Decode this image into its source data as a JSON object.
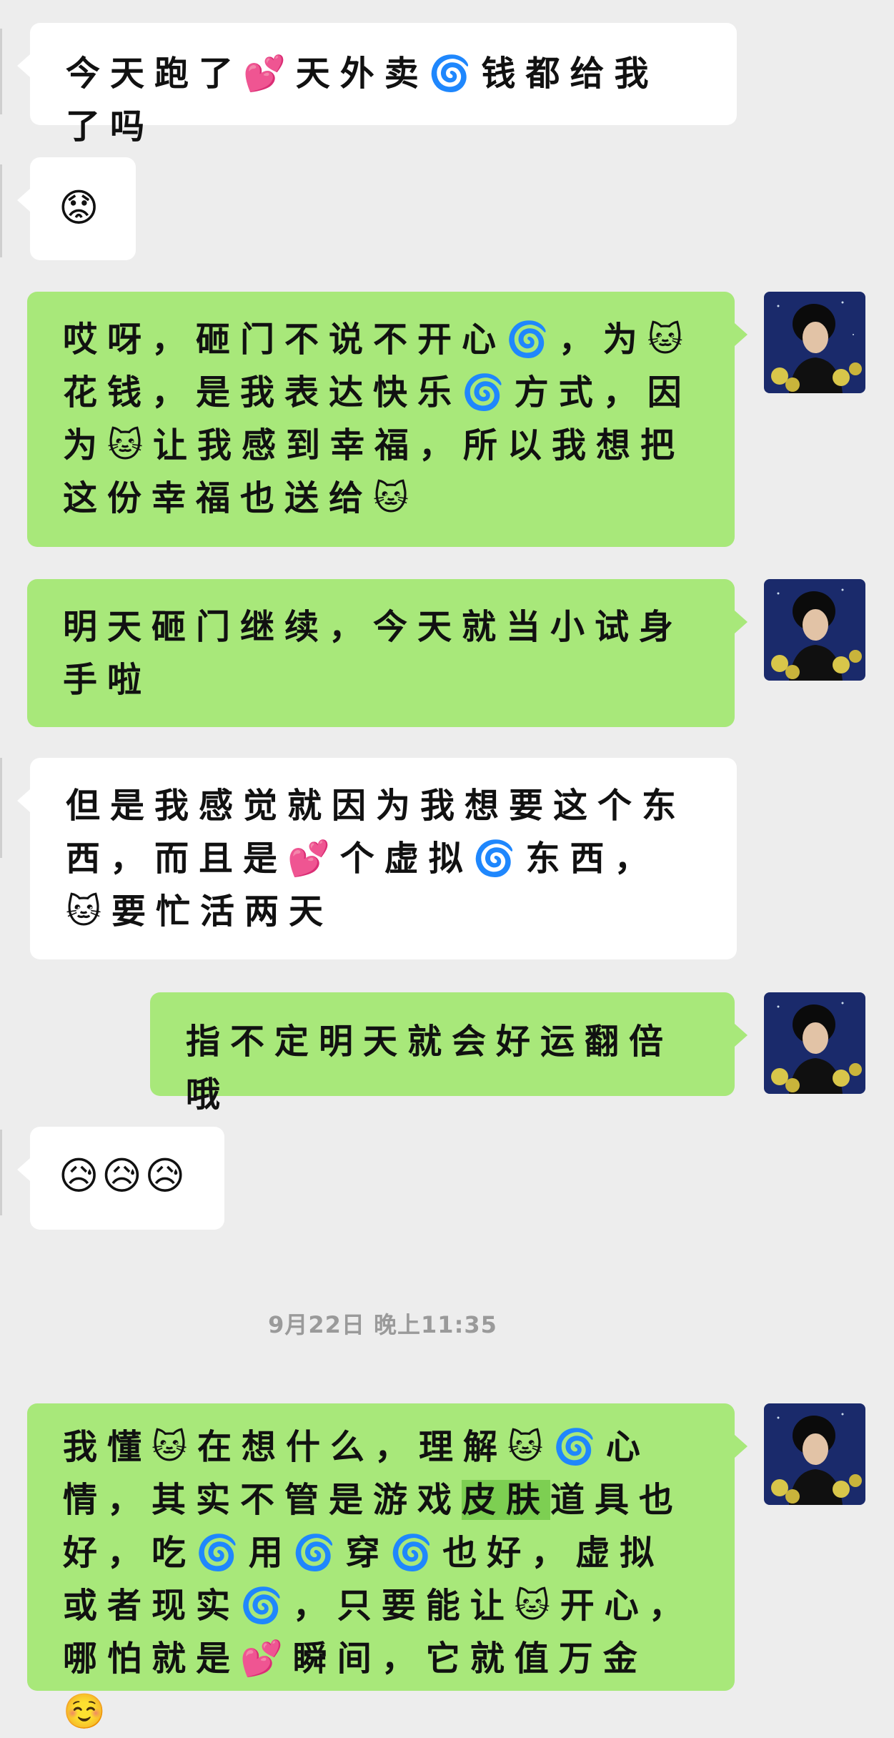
{
  "chat": {
    "messages": [
      {
        "side": "left",
        "text": "今天跑了💕天外卖🌀钱都给我了吗"
      },
      {
        "side": "left",
        "text": "😟"
      },
      {
        "side": "right",
        "text": "哎呀，砸门不说不开心🌀，为🐱花钱，是我表达快乐🌀方式，因为🐱让我感到幸福，所以我想把这份幸福也送给🐱"
      },
      {
        "side": "right",
        "text": "明天砸门继续，今天就当小试身手啦"
      },
      {
        "side": "left",
        "text": "但是我感觉就因为我想要这个东西，而且是💕个虚拟🌀东西，🐱要忙活两天"
      },
      {
        "side": "right",
        "text": "指不定明天就会好运翻倍哦"
      },
      {
        "side": "left",
        "text": "😥😥😥"
      },
      {
        "side": "right",
        "text_before": "我懂🐱在想什么，理解🐱🌀心情，其实不管是游戏",
        "highlight": "皮肤",
        "text_after": "道具也好，吃🌀用🌀穿🌀也好，虚拟或者现实🌀，只要能让🐱开心，哪怕就是💕瞬间，它就值万金☺️"
      }
    ],
    "timestamp": "9月22日 晚上11:35"
  },
  "colors": {
    "background": "#ededed",
    "bubble_left": "#ffffff",
    "bubble_right": "#a8e87a",
    "highlight": "#7dcf52"
  }
}
